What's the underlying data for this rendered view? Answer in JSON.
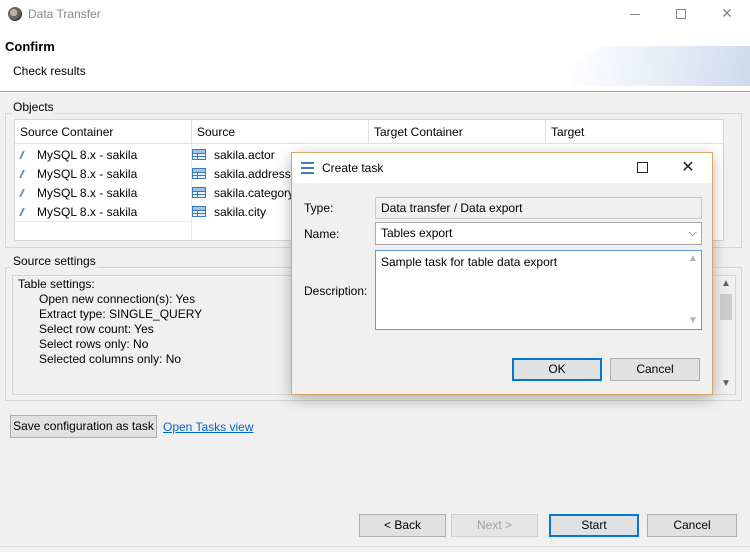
{
  "window": {
    "title": "Data Transfer",
    "minimize_label": "",
    "close_glyph": "✕"
  },
  "banner": {
    "title": "Confirm",
    "subtitle": "Check results"
  },
  "objects": {
    "label": "Objects",
    "columns": [
      "Source Container",
      "Source",
      "Target Container",
      "Target"
    ],
    "rows": [
      {
        "container": "MySQL 8.x - sakila",
        "source": "sakila.actor"
      },
      {
        "container": "MySQL 8.x - sakila",
        "source": "sakila.address"
      },
      {
        "container": "MySQL 8.x - sakila",
        "source": "sakila.category"
      },
      {
        "container": "MySQL 8.x - sakila",
        "source": "sakila.city"
      }
    ]
  },
  "source_settings": {
    "label": "Source settings",
    "heading": "Table settings:",
    "lines": [
      "Open new connection(s): Yes",
      "Extract type: SINGLE_QUERY",
      "Select row count: Yes",
      "Select rows only: No",
      "Selected columns only: No"
    ]
  },
  "actions": {
    "save_task_label": "Save configuration as task",
    "open_tasks_label": "Open Tasks view"
  },
  "footer": {
    "back_label": "< Back",
    "next_label": "Next >",
    "start_label": "Start",
    "cancel_label": "Cancel"
  },
  "dialog": {
    "title": "Create task",
    "close_glyph": "✕",
    "type_label": "Type:",
    "type_value": "Data transfer / Data export",
    "name_label": "Name:",
    "name_value": "Tables export",
    "description_label": "Description:",
    "description_value": "Sample task for table data export",
    "ok_label": "OK",
    "cancel_label": "Cancel"
  },
  "icons": {
    "app": "dbeaver-beaver-icon",
    "connection": "mysql-connection-icon",
    "table": "table-icon",
    "task": "task-list-icon"
  }
}
